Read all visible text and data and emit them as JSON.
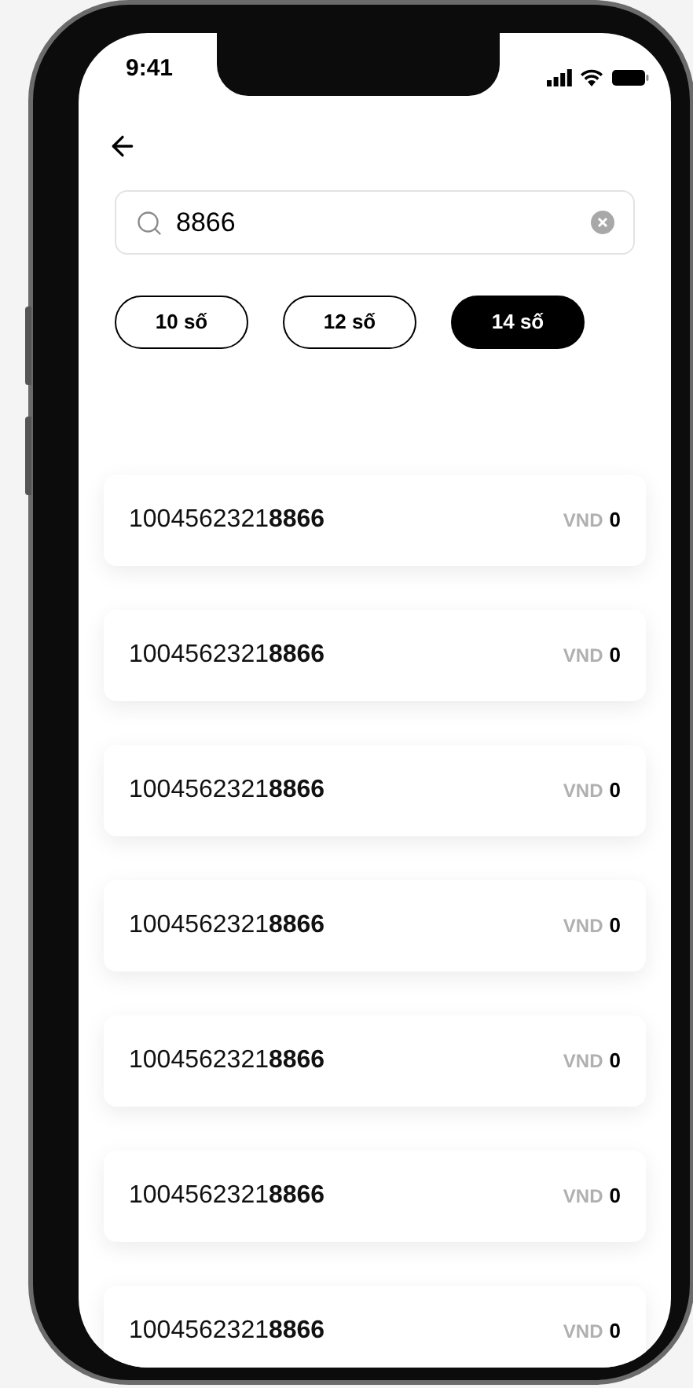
{
  "status_bar": {
    "time": "9:41"
  },
  "search": {
    "value": "8866"
  },
  "filters": [
    {
      "label": "10 số",
      "selected": false
    },
    {
      "label": "12 số",
      "selected": false
    },
    {
      "label": "14 số",
      "selected": true
    }
  ],
  "accounts": [
    {
      "number": "1004562321**8866**",
      "currency": "VND",
      "balance": "0"
    },
    {
      "number": "1004562321**8866**",
      "currency": "VND",
      "balance": "0"
    },
    {
      "number": "1004562321**8866**",
      "currency": "VND",
      "balance": "0"
    },
    {
      "number": "1004562321**8866**",
      "currency": "VND",
      "balance": "0"
    },
    {
      "number": "1004562321**8866**",
      "currency": "VND",
      "balance": "0"
    },
    {
      "number": "1004562321**8866**",
      "currency": "VND",
      "balance": "0"
    },
    {
      "number": "1004562321**8866**",
      "currency": "VND",
      "balance": "0"
    }
  ]
}
